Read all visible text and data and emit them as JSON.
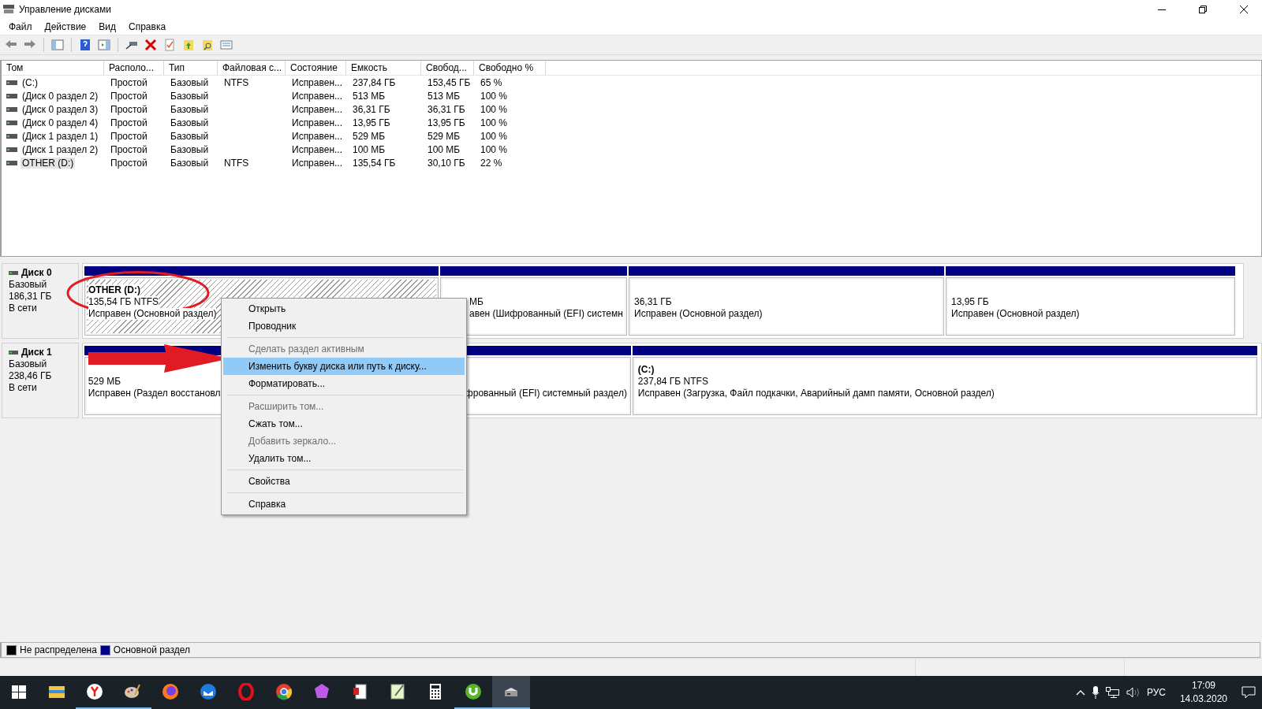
{
  "window": {
    "title": "Управление дисками"
  },
  "menu": [
    "Файл",
    "Действие",
    "Вид",
    "Справка"
  ],
  "table": {
    "columns": [
      "Том",
      "Располо...",
      "Тип",
      "Файловая с...",
      "Состояние",
      "Емкость",
      "Свобод...",
      "Свободно %"
    ],
    "rows": [
      {
        "selected": false,
        "cells": [
          "(C:)",
          "Простой",
          "Базовый",
          "NTFS",
          "Исправен...",
          "237,84 ГБ",
          "153,45 ГБ",
          "65 %"
        ]
      },
      {
        "selected": false,
        "cells": [
          "(Диск 0 раздел 2)",
          "Простой",
          "Базовый",
          "",
          "Исправен...",
          "513 МБ",
          "513 МБ",
          "100 %"
        ]
      },
      {
        "selected": false,
        "cells": [
          "(Диск 0 раздел 3)",
          "Простой",
          "Базовый",
          "",
          "Исправен...",
          "36,31 ГБ",
          "36,31 ГБ",
          "100 %"
        ]
      },
      {
        "selected": false,
        "cells": [
          "(Диск 0 раздел 4)",
          "Простой",
          "Базовый",
          "",
          "Исправен...",
          "13,95 ГБ",
          "13,95 ГБ",
          "100 %"
        ]
      },
      {
        "selected": false,
        "cells": [
          "(Диск 1 раздел 1)",
          "Простой",
          "Базовый",
          "",
          "Исправен...",
          "529 МБ",
          "529 МБ",
          "100 %"
        ]
      },
      {
        "selected": false,
        "cells": [
          "(Диск 1 раздел 2)",
          "Простой",
          "Базовый",
          "",
          "Исправен...",
          "100 МБ",
          "100 МБ",
          "100 %"
        ]
      },
      {
        "selected": true,
        "cells": [
          "OTHER (D:)",
          "Простой",
          "Базовый",
          "NTFS",
          "Исправен...",
          "135,54 ГБ",
          "30,10 ГБ",
          "22 %"
        ]
      }
    ]
  },
  "disks": [
    {
      "name": "Диск 0",
      "type": "Базовый",
      "size": "186,31 ГБ",
      "status": "В сети",
      "partitions": [
        {
          "label": "OTHER  (D:)",
          "size": "135,54 ГБ NTFS",
          "status": "Исправен (Основной раздел)",
          "selected": true
        },
        {
          "size": "МБ",
          "status": "авен (Шифрованный (EFI) системн",
          "selected": false
        },
        {
          "size": "36,31 ГБ",
          "status": "Исправен (Основной раздел)",
          "selected": false
        },
        {
          "size": "13,95 ГБ",
          "status": "Исправен (Основной раздел)",
          "selected": false
        }
      ]
    },
    {
      "name": "Диск 1",
      "type": "Базовый",
      "size": "238,46 ГБ",
      "status": "В сети",
      "partitions": [
        {
          "size": "529 МБ",
          "status": "Исправен (Раздел восстановл",
          "selected": false
        },
        {
          "status": "фрованный (EFI) системный раздел)",
          "selected": false
        },
        {
          "label": "(C:)",
          "size": "237,84 ГБ NTFS",
          "status": "Исправен (Загрузка, Файл подкачки, Аварийный дамп памяти, Основной раздел)",
          "selected": false
        }
      ]
    }
  ],
  "context_menu": [
    {
      "label": "Открыть",
      "disabled": false,
      "selected": false
    },
    {
      "label": "Проводник",
      "disabled": false,
      "selected": false
    },
    {
      "kind": "separator"
    },
    {
      "label": "Сделать раздел активным",
      "disabled": true,
      "selected": false
    },
    {
      "label": "Изменить букву диска или путь к диску...",
      "disabled": false,
      "selected": true
    },
    {
      "label": "Форматировать...",
      "disabled": false,
      "selected": false
    },
    {
      "kind": "separator"
    },
    {
      "label": "Расширить том...",
      "disabled": true,
      "selected": false
    },
    {
      "label": "Сжать том...",
      "disabled": false,
      "selected": false
    },
    {
      "label": "Добавить зеркало...",
      "disabled": true,
      "selected": false
    },
    {
      "label": "Удалить том...",
      "disabled": false,
      "selected": false
    },
    {
      "kind": "separator"
    },
    {
      "label": "Свойства",
      "disabled": false,
      "selected": false
    },
    {
      "kind": "separator"
    },
    {
      "label": "Справка",
      "disabled": false,
      "selected": false
    }
  ],
  "legend": [
    {
      "label": "Не распределена",
      "color": "#000000"
    },
    {
      "label": "Основной раздел",
      "color": "#000080"
    }
  ],
  "taskbar": {
    "apps": [
      {
        "kind": "start",
        "running": false,
        "active": false
      },
      {
        "kind": "folder",
        "running": false,
        "active": false
      },
      {
        "kind": "yandex",
        "running": true,
        "active": false
      },
      {
        "kind": "paint",
        "running": true,
        "active": false
      },
      {
        "kind": "firefox",
        "running": false,
        "active": false
      },
      {
        "kind": "thunderbird",
        "running": false,
        "active": false
      },
      {
        "kind": "opera",
        "running": false,
        "active": false
      },
      {
        "kind": "chrome",
        "running": false,
        "active": false
      },
      {
        "kind": "gem",
        "running": false,
        "active": false
      },
      {
        "kind": "document",
        "running": false,
        "active": false
      },
      {
        "kind": "notepad",
        "running": false,
        "active": false
      },
      {
        "kind": "calculator",
        "running": false,
        "active": false
      },
      {
        "kind": "torrent",
        "running": true,
        "active": false
      },
      {
        "kind": "disk",
        "running": true,
        "active": true
      }
    ],
    "language": "РУС",
    "time": "17:09",
    "date": "14.03.2020"
  }
}
